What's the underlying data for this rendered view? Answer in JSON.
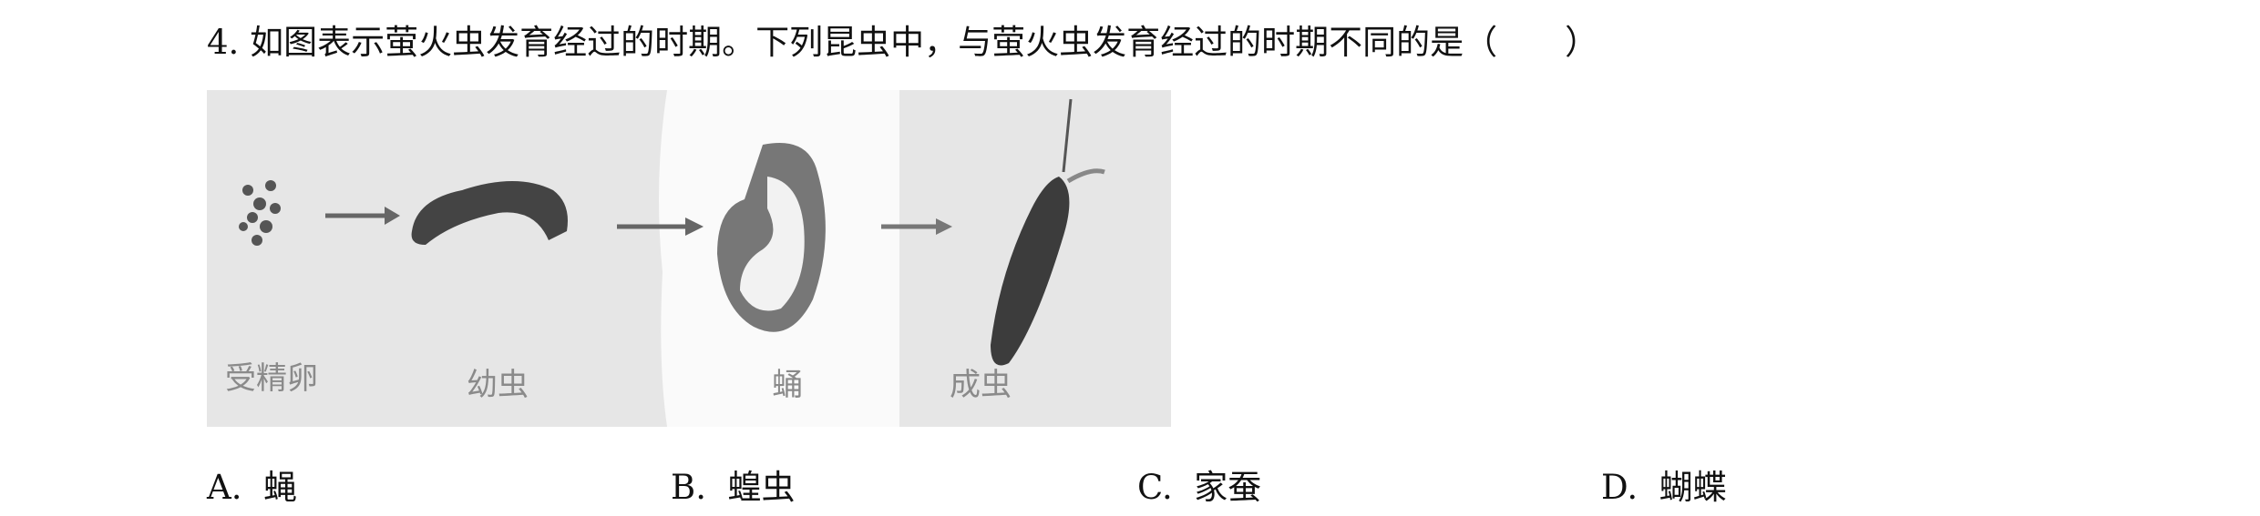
{
  "question": {
    "number": "4.",
    "text": "如图表示萤火虫发育经过的时期。下列昆虫中，与萤火虫发育经过的时期不同的是（　　）"
  },
  "figure": {
    "stages": [
      "受精卵",
      "幼虫",
      "蛹",
      "成虫"
    ]
  },
  "options": [
    {
      "letter": "A.",
      "text": "蝇"
    },
    {
      "letter": "B.",
      "text": "蝗虫"
    },
    {
      "letter": "C.",
      "text": "家蚕"
    },
    {
      "letter": "D.",
      "text": "蝴蝶"
    }
  ]
}
